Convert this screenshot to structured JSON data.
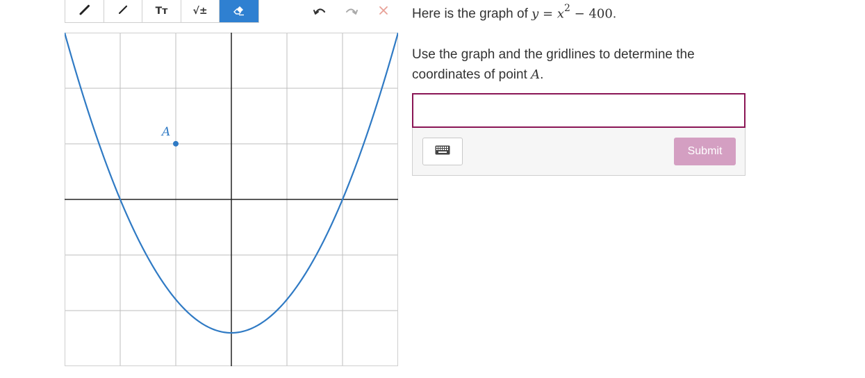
{
  "toolbar": {
    "tools": [
      {
        "name": "pencil-tool",
        "icon": "pencil-icon"
      },
      {
        "name": "line-tool",
        "icon": "line-icon"
      },
      {
        "name": "text-tool",
        "icon": "text-size-icon",
        "label": "Tт"
      },
      {
        "name": "math-tool",
        "icon": "math-icon",
        "label": "√±"
      },
      {
        "name": "eraser-tool",
        "icon": "eraser-icon",
        "active": true
      }
    ],
    "undo_icon": "undo-icon",
    "redo_icon": "redo-icon",
    "clear_icon": "close-icon",
    "active_color": "#2f80d1",
    "clear_color": "#e8a197"
  },
  "prompt": {
    "text": "Here is the graph of ",
    "equation_lhs": "y",
    "equation_eq": " = ",
    "equation_var": "x",
    "equation_exp": "2",
    "equation_rest": " − 400",
    "period": "."
  },
  "question": {
    "text": "Use the graph and the gridlines to determine the coordinates of point ",
    "point": "A",
    "period": "."
  },
  "answer": {
    "value": "",
    "placeholder": "",
    "border_color": "#8a1555",
    "keyboard_icon": "keyboard-icon",
    "submit_label": "Submit",
    "submit_color": "#d49fc2"
  },
  "chart_data": {
    "type": "line",
    "function": "y = x^2 - 400",
    "xlim": [
      -30,
      30
    ],
    "ylim": [
      -500,
      500
    ],
    "grid_step_x": 10,
    "grid_step_y": 167,
    "curve_color": "#2f7ac4",
    "point": {
      "label": "A",
      "x": -10,
      "y": 167
    }
  }
}
